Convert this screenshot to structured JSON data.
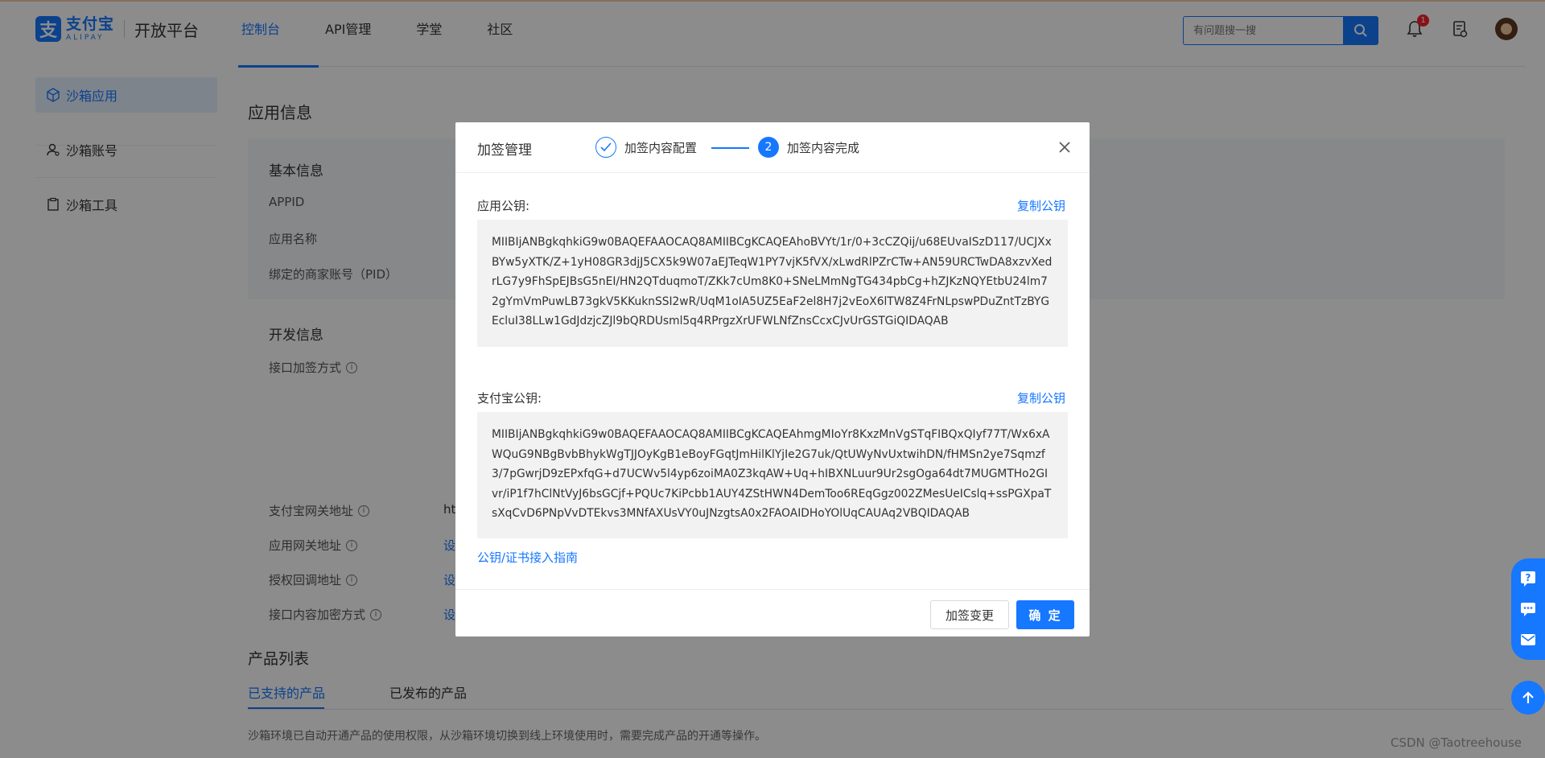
{
  "header": {
    "logo_cn": "支付宝",
    "logo_en": "ALIPAY",
    "platform": "开放平台",
    "nav": [
      "控制台",
      "API管理",
      "学堂",
      "社区"
    ],
    "search_placeholder": "有问题搜一搜",
    "notification_count": "1"
  },
  "sidebar": {
    "items": [
      "沙箱应用",
      "沙箱账号",
      "沙箱工具"
    ]
  },
  "main": {
    "section_title": "应用信息",
    "basic_title": "基本信息",
    "basic_labels": [
      "APPID",
      "应用名称",
      "绑定的商家账号（PID）"
    ],
    "dev_title": "开发信息",
    "dev_label_sign": "接口加签方式",
    "gateway_labels": [
      "支付宝网关地址",
      "应用网关地址",
      "授权回调地址",
      "接口内容加密方式"
    ],
    "truncated_values": [
      "ht",
      "设",
      "设",
      "设"
    ],
    "products_title": "产品列表",
    "product_tabs": [
      "已支持的产品",
      "已发布的产品"
    ],
    "notice": "沙箱环境已自动开通产品的使用权限，从沙箱环境切换到线上环境使用时，需要完成产品的开通等操作。"
  },
  "modal": {
    "title": "加签管理",
    "step1": "加签内容配置",
    "step2_num": "2",
    "step2": "加签内容完成",
    "app_key_label": "应用公钥:",
    "alipay_key_label": "支付宝公钥:",
    "copy_label": "复制公钥",
    "app_key": "MIIBIjANBgkqhkiG9w0BAQEFAAOCAQ8AMIIBCgKCAQEAhoBVYt/1r/0+3cCZQij/u68EUvaISzD117/UCJXxBYw5yXTK/Z+1yH08GR3djJ5CX5k9W07aEJTeqW1PY7vjK5fVX/xLwdRlPZrCTw+AN59URCTwDA8xzvXedrLG7y9FhSpEJBsG5nEI/HN2QTduqmoT/ZKk7cUm8K0+SNeLMmNgTG434pbCg+hZJKzNQYEtbU24lm72gYmVmPuwLB73gkV5KKuknSSI2wR/UqM1oIA5UZ5EaF2el8H7j2vEoX6lTW8Z4FrNLpswPDuZntTzBYGEcluI38LLw1GdJdzjcZJl9bQRDUsml5q4RPrgzXrUFWLNfZnsCcxCJvUrGSTGiQIDAQAB",
    "alipay_key": "MIIBIjANBgkqhkiG9w0BAQEFAAOCAQ8AMIIBCgKCAQEAhmgMIoYr8KxzMnVgSTqFIBQxQIyf77T/Wx6xAWQuG9NBgBvbBhykWgTJJOyKgB1eBoyFGqtJmHilKlYjIe2G7uk/QtUWyNvUxtwihDN/fHMSn2ye7Sqmzf3/7pGwrjD9zEPxfqG+d7UCWv5l4yp6zoiMA0Z3kqAW+Uq+hIBXNLuur9Ur2sgOga64dt7MUGMTHo2GIvr/iP1f7hClNtVyJ6bsGCjf+PQUc7KiPcbb1AUY4ZStHWN4DemToo6REqGgz002ZMesUeICslq+ssPGXpaTsXqCvD6PNpVvDTEkvs3MNfAXUsVY0uJNzgtsA0x2FAOAIDHoYOlUqCAUAq2VBQIDAQAB",
    "guide_link": "公钥/证书接入指南",
    "btn_change": "加签变更",
    "btn_ok": "确 定"
  },
  "watermark": "CSDN @Taotreehouse",
  "colors": {
    "primary": "#1677ff",
    "overlay": "rgba(0,0,0,0.45)"
  }
}
